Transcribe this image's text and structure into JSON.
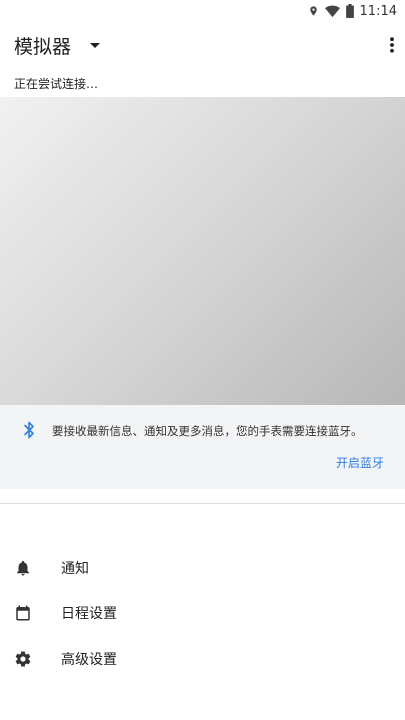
{
  "status_bar": {
    "time": "11:14",
    "icons": [
      "location-icon",
      "wifi-icon",
      "battery-icon"
    ]
  },
  "app_bar": {
    "title": "模拟器",
    "dropdown_icon": "arrow-drop-down-icon",
    "overflow_icon": "more-vert-icon"
  },
  "connection": {
    "status": "正在尝试连接…"
  },
  "bluetooth_card": {
    "icon": "bluetooth-icon",
    "message": "要接收最新信息、通知及更多消息，您的手表需要连接蓝牙。",
    "action_label": "开启蓝牙",
    "accent_color": "#2f7fe0"
  },
  "menu": {
    "items": [
      {
        "icon": "bell-icon",
        "label": "通知"
      },
      {
        "icon": "calendar-icon",
        "label": "日程设置"
      },
      {
        "icon": "gear-icon",
        "label": "高级设置"
      }
    ]
  }
}
